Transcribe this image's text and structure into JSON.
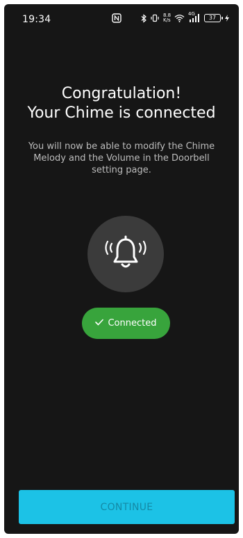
{
  "status_bar": {
    "time": "19:34",
    "net_speed_top": "8.8",
    "net_speed_bottom": "K/s",
    "signal_label": "4G",
    "battery": "37"
  },
  "main": {
    "title_line1": "Congratulation!",
    "title_line2": "Your Chime is connected",
    "subtitle": "You will now be able to modify the Chime Melody and the Volume in the Doorbell setting page.",
    "connected_label": "Connected",
    "continue_label": "CONTINUE"
  },
  "colors": {
    "background": "#161616",
    "accent": "#1cc2e6",
    "success": "#38a43c"
  },
  "icons": {
    "bell": "bell-ringing-icon",
    "check": "check-icon"
  }
}
